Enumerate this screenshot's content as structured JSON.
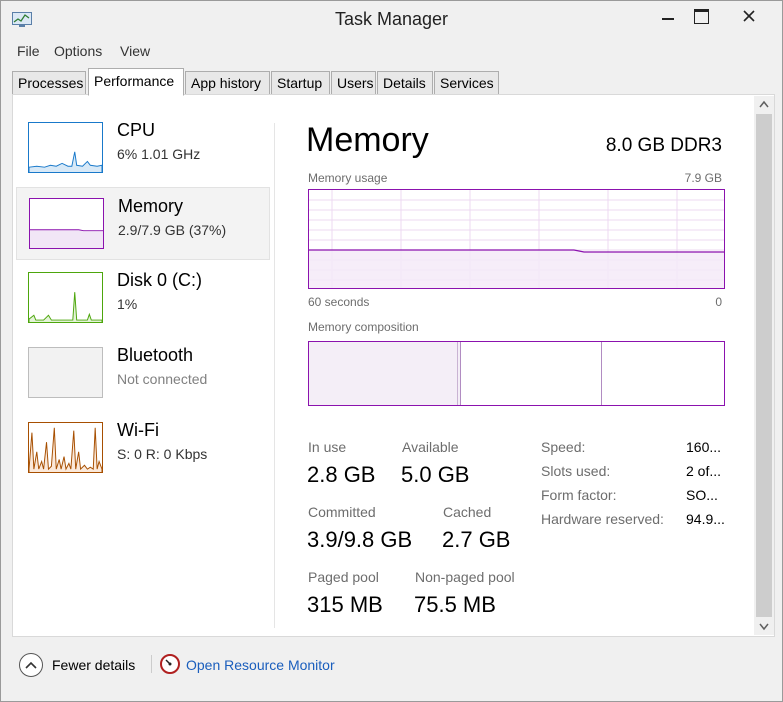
{
  "window": {
    "title": "Task Manager"
  },
  "menu": [
    "File",
    "Options",
    "View"
  ],
  "tabs": [
    {
      "label": "Processes",
      "active": false
    },
    {
      "label": "Performance",
      "active": true
    },
    {
      "label": "App history",
      "active": false
    },
    {
      "label": "Startup",
      "active": false
    },
    {
      "label": "Users",
      "active": false
    },
    {
      "label": "Details",
      "active": false
    },
    {
      "label": "Services",
      "active": false
    }
  ],
  "sidebar": {
    "items": [
      {
        "title": "CPU",
        "sub": "6%  1.01 GHz",
        "color": "#1979ca"
      },
      {
        "title": "Memory",
        "sub": "2.9/7.9 GB (37%)",
        "color": "#8b12ae"
      },
      {
        "title": "Disk 0 (C:)",
        "sub": "1%",
        "color": "#4da60c"
      },
      {
        "title": "Bluetooth",
        "sub": "Not connected",
        "color": "#9b9b9b"
      },
      {
        "title": "Wi-Fi",
        "sub": "S: 0  R: 0 Kbps",
        "color": "#a74f01"
      }
    ]
  },
  "main": {
    "title": "Memory",
    "spec": "8.0 GB DDR3",
    "usage_label": "Memory usage",
    "usage_max": "7.9 GB",
    "time_label": "60 seconds",
    "time_end": "0",
    "composition_label": "Memory composition",
    "in_use_label": "In use",
    "in_use": "2.8 GB",
    "available_label": "Available",
    "available": "5.0 GB",
    "committed_label": "Committed",
    "committed": "3.9/9.8 GB",
    "cached_label": "Cached",
    "cached": "2.7 GB",
    "paged_label": "Paged pool",
    "paged": "315 MB",
    "nonpaged_label": "Non-paged pool",
    "nonpaged": "75.5 MB",
    "specs": [
      {
        "label": "Speed:",
        "value": "160..."
      },
      {
        "label": "Slots used:",
        "value": "2 of..."
      },
      {
        "label": "Form factor:",
        "value": "SO..."
      },
      {
        "label": "Hardware reserved:",
        "value": "94.9..."
      }
    ]
  },
  "footer": {
    "fewer_details": "Fewer details",
    "open_resmon": "Open Resource Monitor"
  }
}
